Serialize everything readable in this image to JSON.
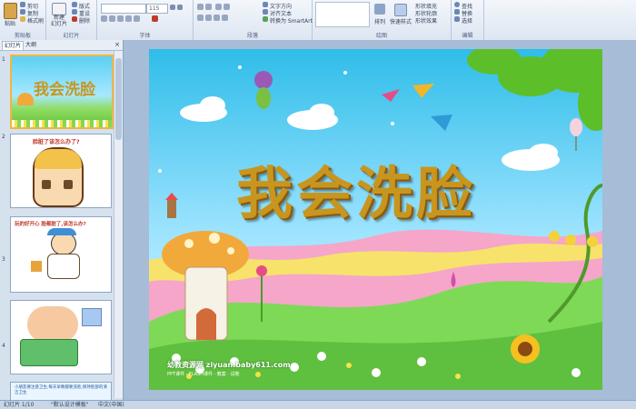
{
  "ribbon": {
    "clipboard": {
      "label": "剪贴板",
      "paste": "粘贴",
      "cut": "剪切",
      "copy": "复制",
      "format_painter": "格式刷"
    },
    "slides": {
      "label": "幻灯片",
      "new_slide": "新建\n幻灯片",
      "layout": "版式",
      "reset": "重设",
      "delete": "删除"
    },
    "font": {
      "label": "字体",
      "size": "115"
    },
    "paragraph": {
      "label": "段落",
      "text_direction": "文字方向",
      "align_text": "对齐文本",
      "smartart": "转换为 SmartArt"
    },
    "drawing": {
      "label": "绘图",
      "arrange": "排列",
      "quick_styles": "快速样式",
      "shape_fill": "形状填充",
      "shape_outline": "形状轮廓",
      "shape_effects": "形状效果"
    },
    "editing": {
      "label": "编辑",
      "find": "查找",
      "replace": "替换",
      "select": "选择"
    }
  },
  "panel": {
    "tab_slides": "幻灯片",
    "tab_outline": "大纲",
    "thumbnails": [
      {
        "num": "1",
        "text": "我会洗脸"
      },
      {
        "num": "2",
        "text": "脸脏了该怎么办了?"
      },
      {
        "num": "3",
        "text": "玩的好开心 脸都脏了,该怎么办?"
      },
      {
        "num": "4",
        "text": ""
      },
      {
        "num": "5",
        "text": "小朋友要注意卫生,每天早晚都要洗脸,保持脸部的清洁卫生"
      }
    ]
  },
  "slide": {
    "title": "我会洗脸",
    "watermark": "幼教资源网 ziyuan.baby611.com",
    "watermark_sub": "PPT课件 · FLASH课件 · 教案 · 试卷"
  },
  "status": {
    "slide_index": "幻灯片 1/10",
    "theme": "\"默认设计模板\"",
    "language": "中文(中国)"
  },
  "colors": {
    "accent": "#f0b640",
    "title": "#c8961e",
    "sky": "#4fc7ef",
    "grass": "#7ed957"
  }
}
